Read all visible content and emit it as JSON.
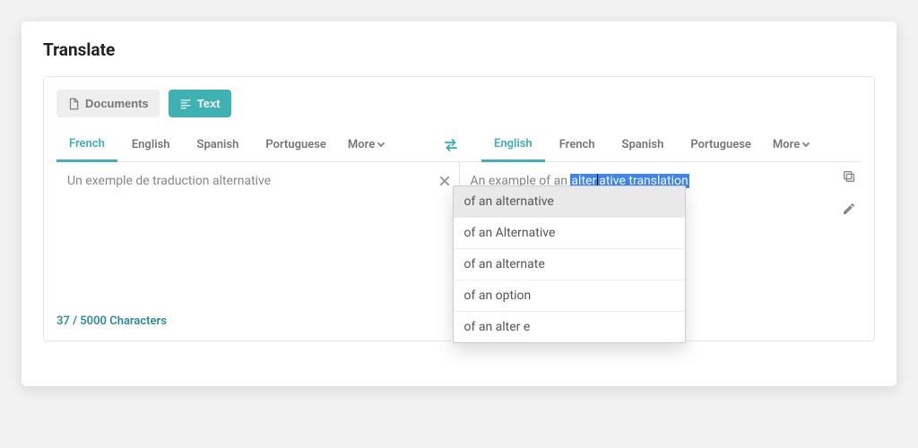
{
  "page": {
    "title": "Translate"
  },
  "modes": {
    "documents": "Documents",
    "text": "Text"
  },
  "source_langs": {
    "items": [
      "French",
      "English",
      "Spanish",
      "Portuguese"
    ],
    "active_index": 0,
    "more_label": "More"
  },
  "target_langs": {
    "items": [
      "English",
      "French",
      "Spanish",
      "Portuguese"
    ],
    "active_index": 0,
    "more_label": "More"
  },
  "source_text": "Un exemple de traduction alternative",
  "target": {
    "prefix": "An example of an",
    "highlighted_before": "alter",
    "highlighted_after": "ative translation"
  },
  "suggestions": [
    "of an alternative",
    "of an Alternative",
    "of an alternate",
    "of an option",
    "of an alter e"
  ],
  "char_counter": "37 / 5000 Characters"
}
